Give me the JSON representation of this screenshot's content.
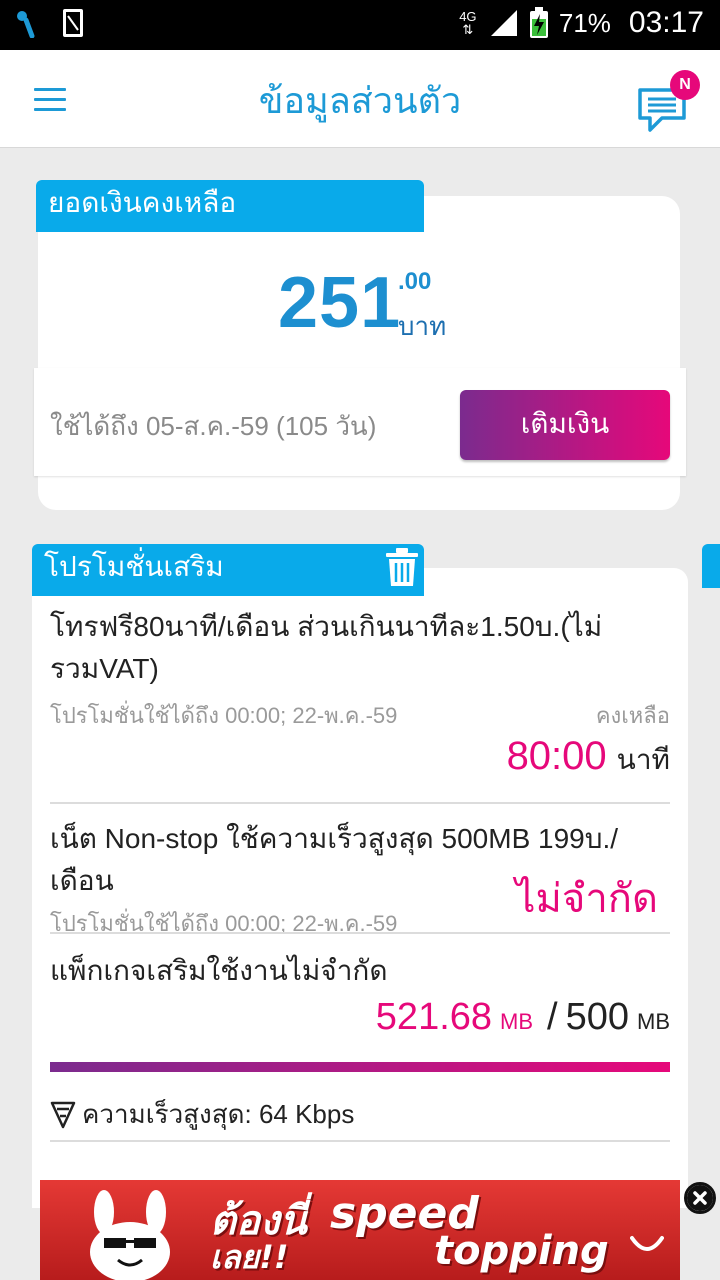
{
  "status_bar": {
    "network_type": "4G",
    "battery_percent": "71%",
    "time": "03:17"
  },
  "header": {
    "title": "ข้อมูลส่วนตัว",
    "notification_badge": "N"
  },
  "balance": {
    "section_label": "ยอดเงินคงเหลือ",
    "amount_whole": "251",
    "amount_decimal": ".00",
    "currency": "บาท",
    "expiry_text": "ใช้ได้ถึง 05-ส.ค.-59 (105 วัน)",
    "topup_label": "เติมเงิน"
  },
  "promotions": {
    "section_label": "โปรโมชั่นเสริม",
    "items": [
      {
        "name_line1": "โทรฟรี80นาที/เดือน ส่วนเกินนาทีละ1.50บ.(ไม่",
        "name_line2": "รวมVAT)",
        "valid_until": "โปรโมชั่นใช้ได้ถึง 00:00; 22-พ.ค.-59",
        "remaining_label": "คงเหลือ",
        "remaining_value": "80:00",
        "remaining_unit": "นาที"
      },
      {
        "name_line1": "เน็ต Non-stop ใช้ความเร็วสูงสุด 500MB 199บ./เดือน",
        "valid_until": "โปรโมชั่นใช้ได้ถึง 00:00; 22-พ.ค.-59",
        "remaining_value": "ไม่จำกัด"
      },
      {
        "name_line1": "แพ็กเกจเสริมใช้งานไม่จำกัด",
        "used_value": "521.68",
        "used_unit": "MB",
        "separator": "/",
        "total_value": "500",
        "total_unit": "MB",
        "speed_text": "ความเร็วสูงสุด: 64 Kbps"
      }
    ]
  },
  "ad": {
    "line1": "ต้องนี่",
    "line2": "เลย!!",
    "speed": "speed",
    "topping": "topping"
  },
  "colors": {
    "primary_blue": "#09aaea",
    "magenta": "#e6087a",
    "purple": "#7b2b8e"
  }
}
